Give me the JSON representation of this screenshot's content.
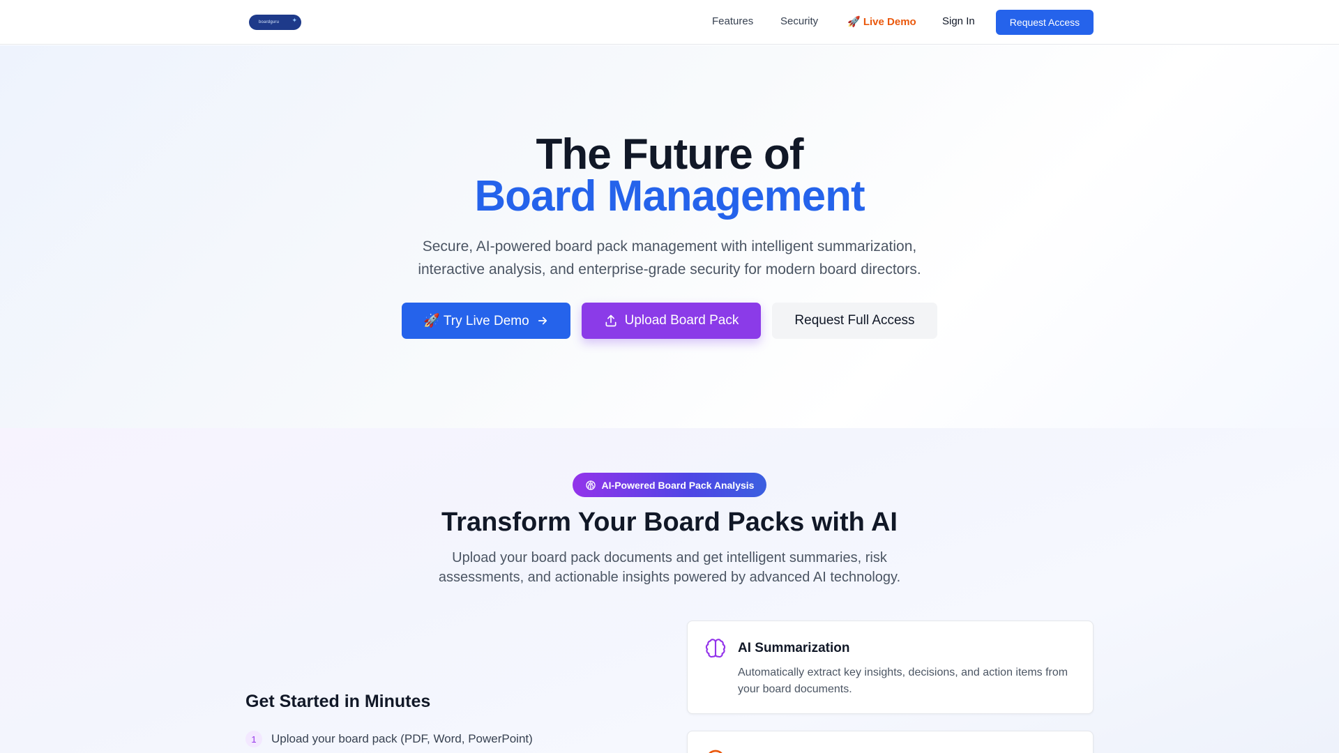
{
  "nav": {
    "logo_text": "boardguru",
    "links": [
      "Features",
      "Security",
      "🚀 Live Demo",
      "Sign In"
    ],
    "cta": "Request Access"
  },
  "hero": {
    "title_line1": "The Future of",
    "title_line2": "Board Management",
    "subtitle": "Secure, AI-powered board pack management with intelligent summarization, interactive analysis, and enterprise-grade security for modern board directors.",
    "buttons": {
      "demo": "🚀 Try Live Demo",
      "upload": "Upload Board Pack",
      "access": "Request Full Access"
    }
  },
  "features": {
    "badge": "AI-Powered Board Pack Analysis",
    "title": "Transform Your Board Packs with AI",
    "subtitle": "Upload your board pack documents and get intelligent summaries, risk assessments, and actionable insights powered by advanced AI technology.",
    "get_started": {
      "title": "Get Started in Minutes",
      "steps": [
        {
          "num": "1",
          "text": "Upload your board pack (PDF, Word, PowerPoint)"
        }
      ]
    },
    "cards": [
      {
        "title": "AI Summarization",
        "description": "Automatically extract key insights, decisions, and action items from your board documents.",
        "icon": "brain-icon"
      },
      {
        "icon": "alert-icon"
      }
    ]
  },
  "colors": {
    "primary": "#2563eb",
    "purple": "#8b3be8",
    "demo_link": "#ea580c",
    "heading": "#111827"
  }
}
